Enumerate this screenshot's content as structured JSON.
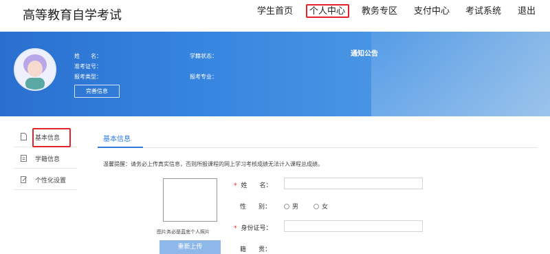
{
  "header": {
    "logo": "高等教育自学考试",
    "nav": [
      "学生首页",
      "个人中心",
      "教务专区",
      "支付中心",
      "考试系统",
      "退出"
    ]
  },
  "banner": {
    "labels": {
      "name": "姓　　名：",
      "admission_no": "准考证号：",
      "exam_type": "报考类型：",
      "status": "学籍状态：",
      "major": "报考专业："
    },
    "perfect_button": "完善信息",
    "notice_title": "通知公告"
  },
  "sidebar": {
    "items": [
      {
        "label": "基本信息",
        "icon": "document-icon"
      },
      {
        "label": "学籍信息",
        "icon": "archive-icon"
      },
      {
        "label": "个性化设置",
        "icon": "edit-icon"
      }
    ]
  },
  "main": {
    "tab": "基本信息",
    "tip": "温馨提醒：请务必上传真实信息，否则所报课程的网上学习考核成绩无法计入课程总成绩。",
    "photo_caption": "图片务必是蓝底个人照片",
    "upload_button": "重新上传",
    "form": {
      "name_label": "姓　　名：",
      "gender_label": "性　　别：",
      "gender_options": [
        "男",
        "女"
      ],
      "id_label": "身份证号：",
      "native_label": "籍　　贯："
    }
  },
  "colors": {
    "accent": "#2f7ad8",
    "highlight_box": "#e0222a",
    "banner": "#3584df"
  }
}
